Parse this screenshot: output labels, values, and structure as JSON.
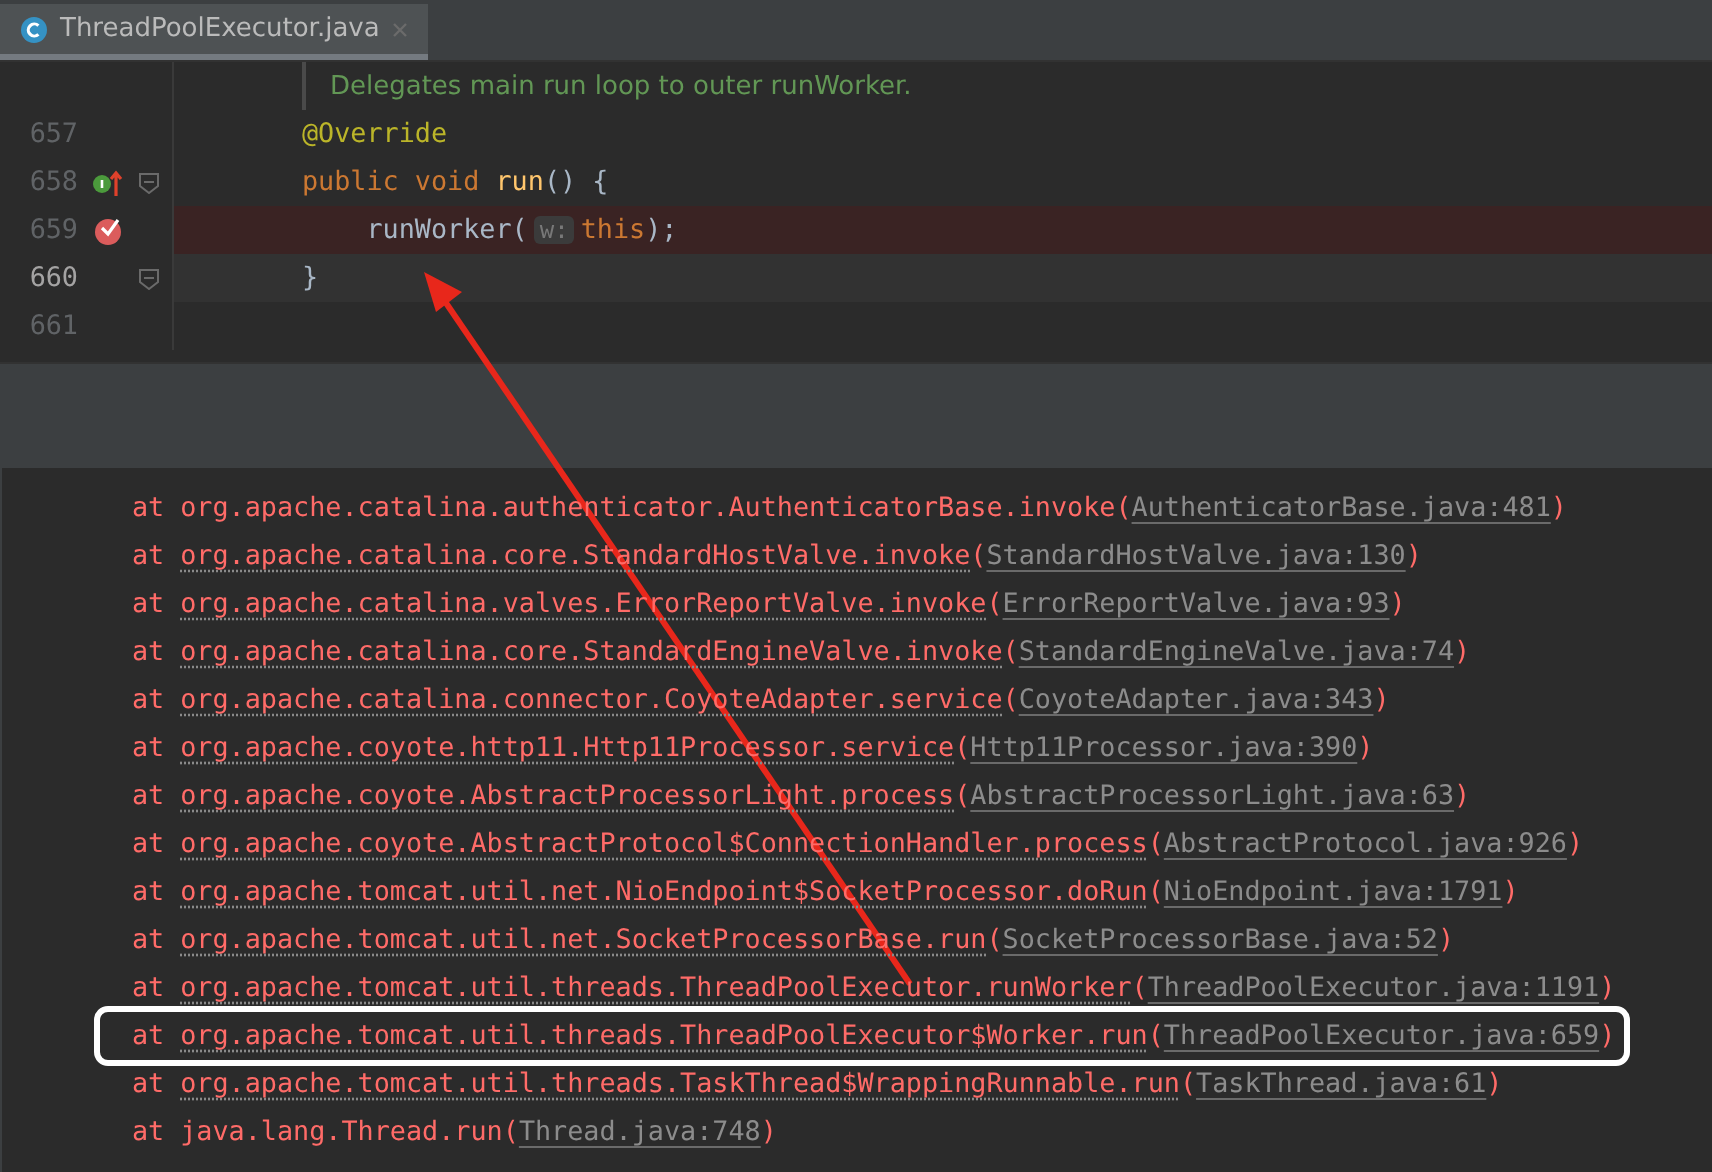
{
  "tab": {
    "title": "ThreadPoolExecutor.java",
    "selected": true
  },
  "code_lines": [
    {
      "kind": "doc",
      "tokens": [
        {
          "kind": "comment",
          "text": "Delegates main run loop to outer runWorker."
        }
      ]
    },
    {
      "kind": "code",
      "number": "657",
      "tokens": [
        {
          "kind": "annotation",
          "text": "@Override"
        }
      ]
    },
    {
      "kind": "code",
      "number": "658",
      "gutter_icons": [
        {
          "kind": "implements"
        },
        {
          "kind": "fold"
        }
      ],
      "tokens": [
        {
          "kind": "keyword",
          "text": "public void "
        },
        {
          "kind": "method",
          "text": "run"
        },
        {
          "kind": "plain",
          "text": "() {"
        }
      ]
    },
    {
      "kind": "breakpoint",
      "number": "659",
      "gutter_icons": [
        {
          "kind": "breakpoint"
        }
      ],
      "tokens": [
        {
          "kind": "plain",
          "text": "    runWorker("
        },
        {
          "kind": "hint",
          "text": "w:"
        },
        {
          "kind": "keyword",
          "text": "this"
        },
        {
          "kind": "plain",
          "text": ");"
        }
      ]
    },
    {
      "kind": "current",
      "number": "660",
      "gutter_icons": [
        {
          "kind": "fold"
        }
      ],
      "tokens": [
        {
          "kind": "plain",
          "text": "}"
        }
      ]
    },
    {
      "kind": "code",
      "number": "661"
    }
  ],
  "console": [
    {
      "prefix": "at",
      "call": "org.apache.catalina.authenticator.AuthenticatorBase.invoke",
      "open": "(",
      "source": "AuthenticatorBase.java:481",
      "close": ")",
      "underlined": false,
      "highlighted": false
    },
    {
      "prefix": "at",
      "call": "org.apache.catalina.core.StandardHostValve.invoke",
      "open": "(",
      "source": "StandardHostValve.java:130",
      "close": ")",
      "underlined": true,
      "highlighted": false
    },
    {
      "prefix": "at",
      "call": "org.apache.catalina.valves.ErrorReportValve.invoke",
      "open": "(",
      "source": "ErrorReportValve.java:93",
      "close": ")",
      "underlined": true,
      "highlighted": false
    },
    {
      "prefix": "at",
      "call": "org.apache.catalina.core.StandardEngineValve.invoke",
      "open": "(",
      "source": "StandardEngineValve.java:74",
      "close": ")",
      "underlined": true,
      "highlighted": false
    },
    {
      "prefix": "at",
      "call": "org.apache.catalina.connector.CoyoteAdapter.service",
      "open": "(",
      "source": "CoyoteAdapter.java:343",
      "close": ")",
      "underlined": true,
      "highlighted": false
    },
    {
      "prefix": "at",
      "call": "org.apache.coyote.http11.Http11Processor.service",
      "open": "(",
      "source": "Http11Processor.java:390",
      "close": ")",
      "underlined": true,
      "highlighted": false
    },
    {
      "prefix": "at",
      "call": "org.apache.coyote.AbstractProcessorLight.process",
      "open": "(",
      "source": "AbstractProcessorLight.java:63",
      "close": ")",
      "underlined": true,
      "highlighted": false
    },
    {
      "prefix": "at",
      "call": "org.apache.coyote.AbstractProtocol$ConnectionHandler.process",
      "open": "(",
      "source": "AbstractProtocol.java:926",
      "close": ")",
      "underlined": true,
      "highlighted": false
    },
    {
      "prefix": "at",
      "call": "org.apache.tomcat.util.net.NioEndpoint$SocketProcessor.doRun",
      "open": "(",
      "source": "NioEndpoint.java:1791",
      "close": ")",
      "underlined": true,
      "highlighted": false
    },
    {
      "prefix": "at",
      "call": "org.apache.tomcat.util.net.SocketProcessorBase.run",
      "open": "(",
      "source": "SocketProcessorBase.java:52",
      "close": ")",
      "underlined": true,
      "highlighted": false
    },
    {
      "prefix": "at",
      "call": "org.apache.tomcat.util.threads.ThreadPoolExecutor.runWorker",
      "open": "(",
      "source": "ThreadPoolExecutor.java:1191",
      "close": ")",
      "underlined": true,
      "highlighted": false
    },
    {
      "prefix": "at",
      "call": "org.apache.tomcat.util.threads.ThreadPoolExecutor$Worker.run",
      "open": "(",
      "source": "ThreadPoolExecutor.java:659",
      "close": ")",
      "underlined": true,
      "highlighted": true
    },
    {
      "prefix": "at",
      "call": "org.apache.tomcat.util.threads.TaskThread$WrappingRunnable.run",
      "open": "(",
      "source": "TaskThread.java:61",
      "close": ")",
      "underlined": true,
      "highlighted": false
    },
    {
      "prefix": "at",
      "call": "java.lang.Thread.run",
      "open": "(",
      "source": "Thread.java:748",
      "close": ")",
      "underlined": false,
      "highlighted": false
    }
  ]
}
